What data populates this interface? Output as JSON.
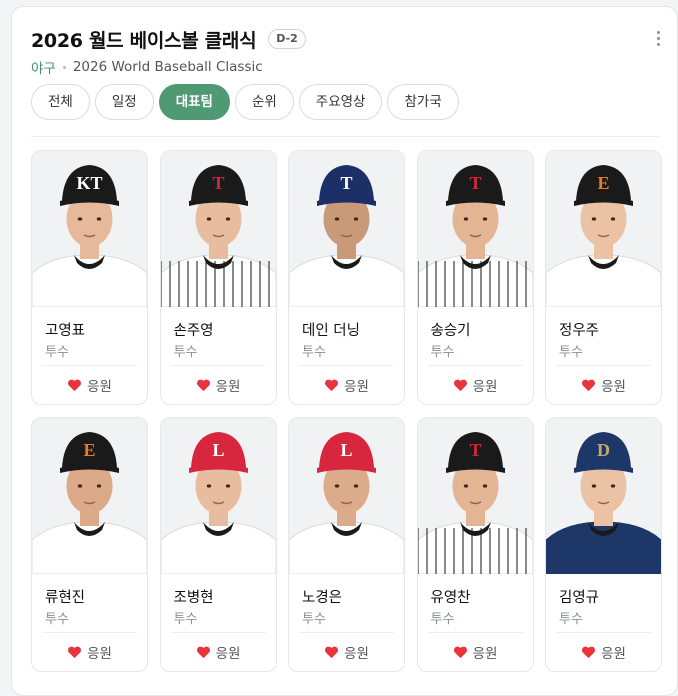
{
  "header": {
    "title": "2026 월드 베이스볼 클래식",
    "badge": "D-2",
    "category": "야구",
    "subtitle": "2026 World Baseball Classic"
  },
  "tabs": [
    {
      "label": "전체",
      "active": false
    },
    {
      "label": "일정",
      "active": false
    },
    {
      "label": "대표팀",
      "active": true
    },
    {
      "label": "순위",
      "active": false
    },
    {
      "label": "주요영상",
      "active": false
    },
    {
      "label": "참가국",
      "active": false
    }
  ],
  "cheer_label": "응원",
  "colors": {
    "accent": "#4f9a73",
    "heart": "#e8343c"
  },
  "players": [
    {
      "name": "고영표",
      "position": "투수",
      "cap": "#1a1a1a",
      "logo_text": "KT",
      "logo_color": "#ffffff",
      "jersey": "#ffffff",
      "stripes": false,
      "skin": "#e6b99a"
    },
    {
      "name": "손주영",
      "position": "투수",
      "cap": "#1a1a1a",
      "logo_text": "T",
      "logo_color": "#d5253a",
      "jersey": "#ffffff",
      "stripes": true,
      "skin": "#e8bd9f"
    },
    {
      "name": "데인 더닝",
      "position": "투수",
      "cap": "#1c2f66",
      "logo_text": "T",
      "logo_color": "#ffffff",
      "jersey": "#ffffff",
      "stripes": false,
      "skin": "#c99a7a"
    },
    {
      "name": "송승기",
      "position": "투수",
      "cap": "#1a1a1a",
      "logo_text": "T",
      "logo_color": "#d5253a",
      "jersey": "#ffffff",
      "stripes": true,
      "skin": "#e4b594"
    },
    {
      "name": "정우주",
      "position": "투수",
      "cap": "#1a1a1a",
      "logo_text": "E",
      "logo_color": "#f07b1f",
      "jersey": "#ffffff",
      "stripes": false,
      "skin": "#ebc2a4"
    },
    {
      "name": "류현진",
      "position": "투수",
      "cap": "#1a1a1a",
      "logo_text": "E",
      "logo_color": "#f07b1f",
      "jersey": "#ffffff",
      "stripes": false,
      "skin": "#ddaa89"
    },
    {
      "name": "조병현",
      "position": "투수",
      "cap": "#d7263d",
      "logo_text": "L",
      "logo_color": "#ffffff",
      "jersey": "#ffffff",
      "stripes": false,
      "skin": "#e8bd9f"
    },
    {
      "name": "노경은",
      "position": "투수",
      "cap": "#d7263d",
      "logo_text": "L",
      "logo_color": "#ffffff",
      "jersey": "#ffffff",
      "stripes": false,
      "skin": "#dcab8b"
    },
    {
      "name": "유영찬",
      "position": "투수",
      "cap": "#1a1a1a",
      "logo_text": "T",
      "logo_color": "#d5253a",
      "jersey": "#ffffff",
      "stripes": true,
      "skin": "#e4b594"
    },
    {
      "name": "김영규",
      "position": "투수",
      "cap": "#1c3768",
      "logo_text": "D",
      "logo_color": "#c9a96b",
      "jersey": "#1c3768",
      "stripes": false,
      "skin": "#ebc2a4"
    }
  ]
}
